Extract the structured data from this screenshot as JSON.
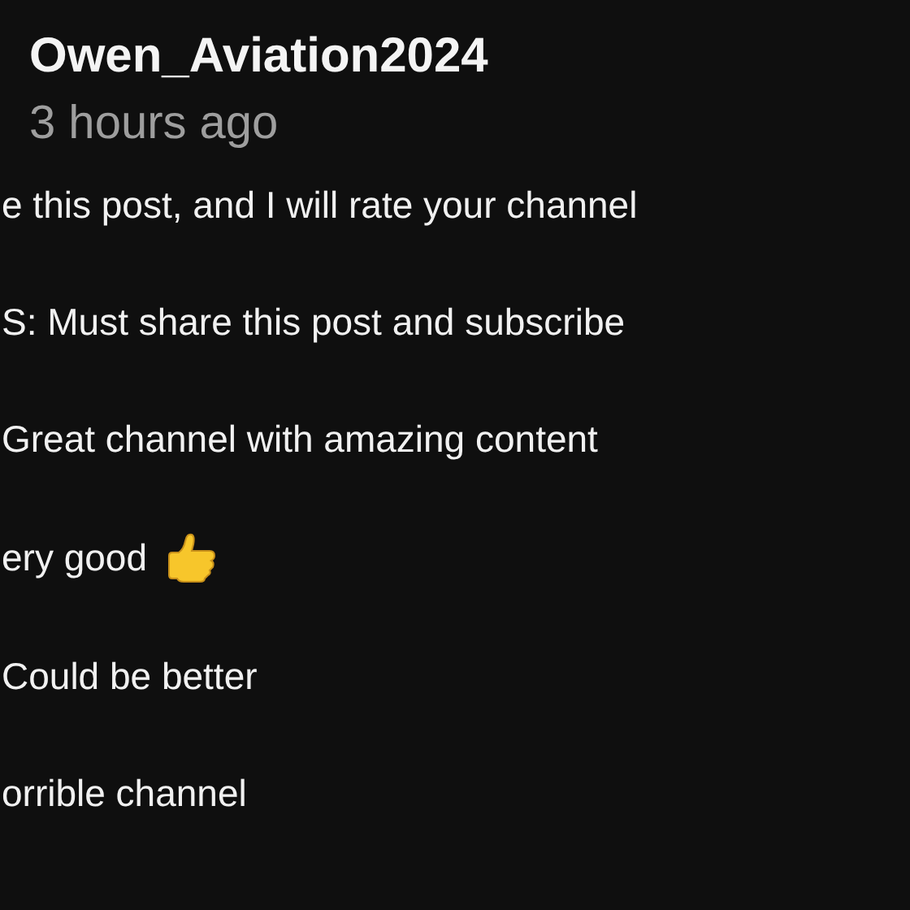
{
  "post": {
    "author": "Owen_Aviation2024",
    "time": "3 hours ago"
  },
  "lines": [
    {
      "text": "e this post, and I will rate your channel"
    },
    {
      "text": "S: Must share this post and subscribe"
    },
    {
      "text": "Great channel with amazing content"
    },
    {
      "text": "ery good",
      "thumbs_up": true
    },
    {
      "text": "Could be better"
    },
    {
      "text": "orrible channel"
    }
  ]
}
